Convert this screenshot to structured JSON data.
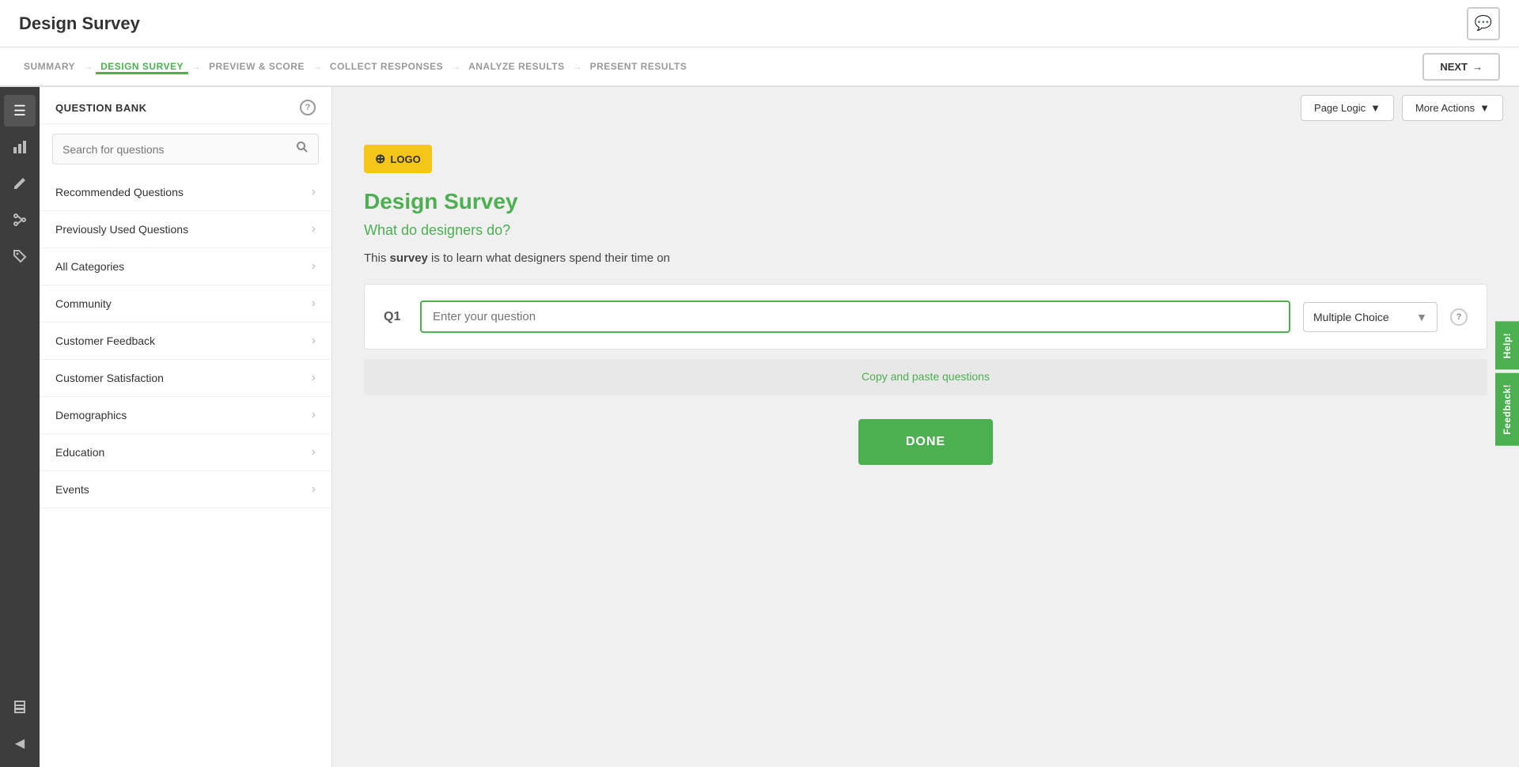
{
  "app": {
    "title": "Design Survey",
    "chat_icon": "💬"
  },
  "nav": {
    "steps": [
      {
        "id": "summary",
        "label": "SUMMARY",
        "active": false
      },
      {
        "id": "design",
        "label": "DESIGN SURVEY",
        "active": true
      },
      {
        "id": "preview",
        "label": "PREVIEW & SCORE",
        "active": false
      },
      {
        "id": "collect",
        "label": "COLLECT RESPONSES",
        "active": false
      },
      {
        "id": "analyze",
        "label": "ANALYZE RESULTS",
        "active": false
      },
      {
        "id": "present",
        "label": "PRESENT RESULTS",
        "active": false
      }
    ],
    "next_label": "NEXT"
  },
  "icon_sidebar": {
    "items": [
      {
        "id": "survey",
        "icon": "☰",
        "active": true
      },
      {
        "id": "chart",
        "icon": "📊",
        "active": false
      },
      {
        "id": "edit",
        "icon": "✏️",
        "active": false
      },
      {
        "id": "branch",
        "icon": "⑂",
        "active": false
      },
      {
        "id": "grid",
        "icon": "⊞",
        "active": false
      },
      {
        "id": "print",
        "icon": "🖨",
        "active": false
      }
    ],
    "collapse_icon": "◀"
  },
  "question_bank": {
    "title": "QUESTION BANK",
    "help_tooltip": "?",
    "search_placeholder": "Search for questions",
    "items": [
      {
        "id": "recommended",
        "label": "Recommended Questions"
      },
      {
        "id": "previously-used",
        "label": "Previously Used Questions"
      },
      {
        "id": "all-categories",
        "label": "All Categories"
      },
      {
        "id": "community",
        "label": "Community"
      },
      {
        "id": "customer-feedback",
        "label": "Customer Feedback"
      },
      {
        "id": "customer-satisfaction",
        "label": "Customer Satisfaction"
      },
      {
        "id": "demographics",
        "label": "Demographics"
      },
      {
        "id": "education",
        "label": "Education"
      },
      {
        "id": "events",
        "label": "Events"
      }
    ]
  },
  "toolbar": {
    "page_logic_label": "Page Logic",
    "more_actions_label": "More Actions"
  },
  "survey": {
    "logo_label": "LOGO",
    "title": "Design Survey",
    "subtitle": "What do designers do?",
    "description_prefix": "This ",
    "description_bold": "survey",
    "description_suffix": " is to learn what designers spend their time on",
    "question_number": "Q1",
    "question_placeholder": "Enter your question",
    "question_type": "Multiple Choice",
    "copy_paste_label": "Copy and paste questions",
    "done_label": "DONE"
  },
  "right_tabs": {
    "help_label": "Help!",
    "feedback_label": "Feedback!"
  },
  "colors": {
    "green": "#4CAF50",
    "yellow": "#f5c518",
    "dark_sidebar": "#3d3d3d"
  }
}
